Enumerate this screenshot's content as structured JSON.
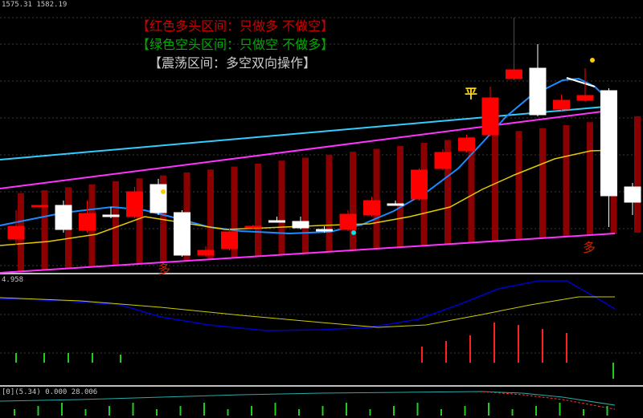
{
  "colors": {
    "bull": "#ff0000",
    "bear": "#ffffff",
    "channel": "#ff33ff",
    "cyan_line": "#33ccff",
    "blue_line": "#1a8cff",
    "yellow_line": "#e6c800",
    "dark_bar": "#8b0000",
    "signal": "#cc2222",
    "hist_up": "#ff2020",
    "hist_down": "#22cc22",
    "macd_blue": "#0000cc",
    "macd_yellow": "#cccc00"
  },
  "header": {
    "price_info": "1575.31 1582.19"
  },
  "legend": {
    "red_zone": "【红色多头区间：只做多 不做空】",
    "green_zone": "【绿色空头区间：只做空 不做多】",
    "range_zone": "【震荡区间：多空双向操作】"
  },
  "signals": {
    "flat_label": "平",
    "long_label_1": "多",
    "long_label_2": "多"
  },
  "subpanel1": {
    "value_label": "4.958"
  },
  "subpanel2": {
    "indicator_label": "[0](5.34) 0.000 28.006"
  },
  "chart_data": {
    "type": "candlestick",
    "candles": [
      {
        "o": 282,
        "h": 262,
        "l": 305,
        "c": 298,
        "bull": true
      },
      {
        "o": 256,
        "h": 256,
        "l": 258,
        "c": 257,
        "bull": true
      },
      {
        "o": 286,
        "h": 250,
        "l": 290,
        "c": 256,
        "bull": false
      },
      {
        "o": 266,
        "h": 250,
        "l": 290,
        "c": 287,
        "bull": true
      },
      {
        "o": 268,
        "h": 258,
        "l": 272,
        "c": 270,
        "bull": false
      },
      {
        "o": 239,
        "h": 233,
        "l": 272,
        "c": 270,
        "bull": true
      },
      {
        "o": 230,
        "h": 223,
        "l": 268,
        "c": 265,
        "bull": false
      },
      {
        "o": 265,
        "h": 262,
        "l": 320,
        "c": 318,
        "bull": false
      },
      {
        "o": 312,
        "h": 307,
        "l": 320,
        "c": 318,
        "bull": true
      },
      {
        "o": 289,
        "h": 285,
        "l": 312,
        "c": 310,
        "bull": true
      },
      {
        "o": 282,
        "h": 280,
        "l": 285,
        "c": 284,
        "bull": true
      },
      {
        "o": 275,
        "h": 270,
        "l": 276,
        "c": 276,
        "bull": false
      },
      {
        "o": 276,
        "h": 270,
        "l": 286,
        "c": 284,
        "bull": false
      },
      {
        "o": 286,
        "h": 282,
        "l": 290,
        "c": 288,
        "bull": false
      },
      {
        "o": 267,
        "h": 262,
        "l": 288,
        "c": 286,
        "bull": true
      },
      {
        "o": 250,
        "h": 245,
        "l": 270,
        "c": 268,
        "bull": true
      },
      {
        "o": 254,
        "h": 250,
        "l": 256,
        "c": 255,
        "bull": false
      },
      {
        "o": 212,
        "h": 210,
        "l": 250,
        "c": 248,
        "bull": true
      },
      {
        "o": 190,
        "h": 186,
        "l": 212,
        "c": 210,
        "bull": true
      },
      {
        "o": 172,
        "h": 168,
        "l": 190,
        "c": 188,
        "bull": true
      },
      {
        "o": 122,
        "h": 108,
        "l": 170,
        "c": 168,
        "bull": true
      },
      {
        "o": 87,
        "h": 22,
        "l": 100,
        "c": 98,
        "bull": true
      },
      {
        "o": 85,
        "h": 55,
        "l": 145,
        "c": 143,
        "bull": false
      },
      {
        "o": 125,
        "h": 118,
        "l": 138,
        "c": 136,
        "bull": true
      },
      {
        "o": 119,
        "h": 85,
        "l": 127,
        "c": 125,
        "bull": true
      },
      {
        "o": 113,
        "h": 110,
        "l": 283,
        "c": 244,
        "bull": false
      },
      {
        "o": 233,
        "h": 228,
        "l": 268,
        "c": 252,
        "bull": false
      }
    ]
  }
}
